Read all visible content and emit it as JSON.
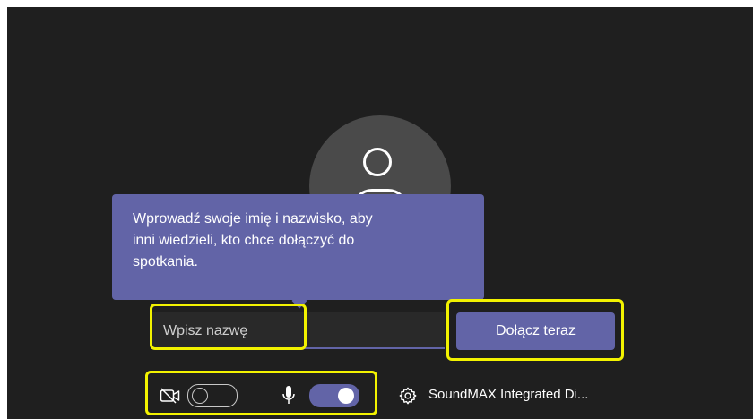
{
  "tooltip": {
    "text_line1": "Wprowadź swoje imię i nazwisko, aby",
    "text_line2": "inni wiedzieli, kto chce dołączyć do",
    "text_line3": "spotkania."
  },
  "name_input": {
    "placeholder": "Wpisz nazwę",
    "value": ""
  },
  "join_button": {
    "label": "Dołącz teraz"
  },
  "controls": {
    "camera": {
      "icon": "camera-off-icon",
      "enabled": false
    },
    "microphone": {
      "icon": "microphone-icon",
      "enabled": true
    },
    "audio_device": {
      "icon": "gear-icon",
      "label": "SoundMAX Integrated Di..."
    }
  },
  "colors": {
    "background": "#1f1f1f",
    "accent": "#6264a7",
    "highlight": "#f2f200",
    "avatar": "#4a4a4a"
  }
}
